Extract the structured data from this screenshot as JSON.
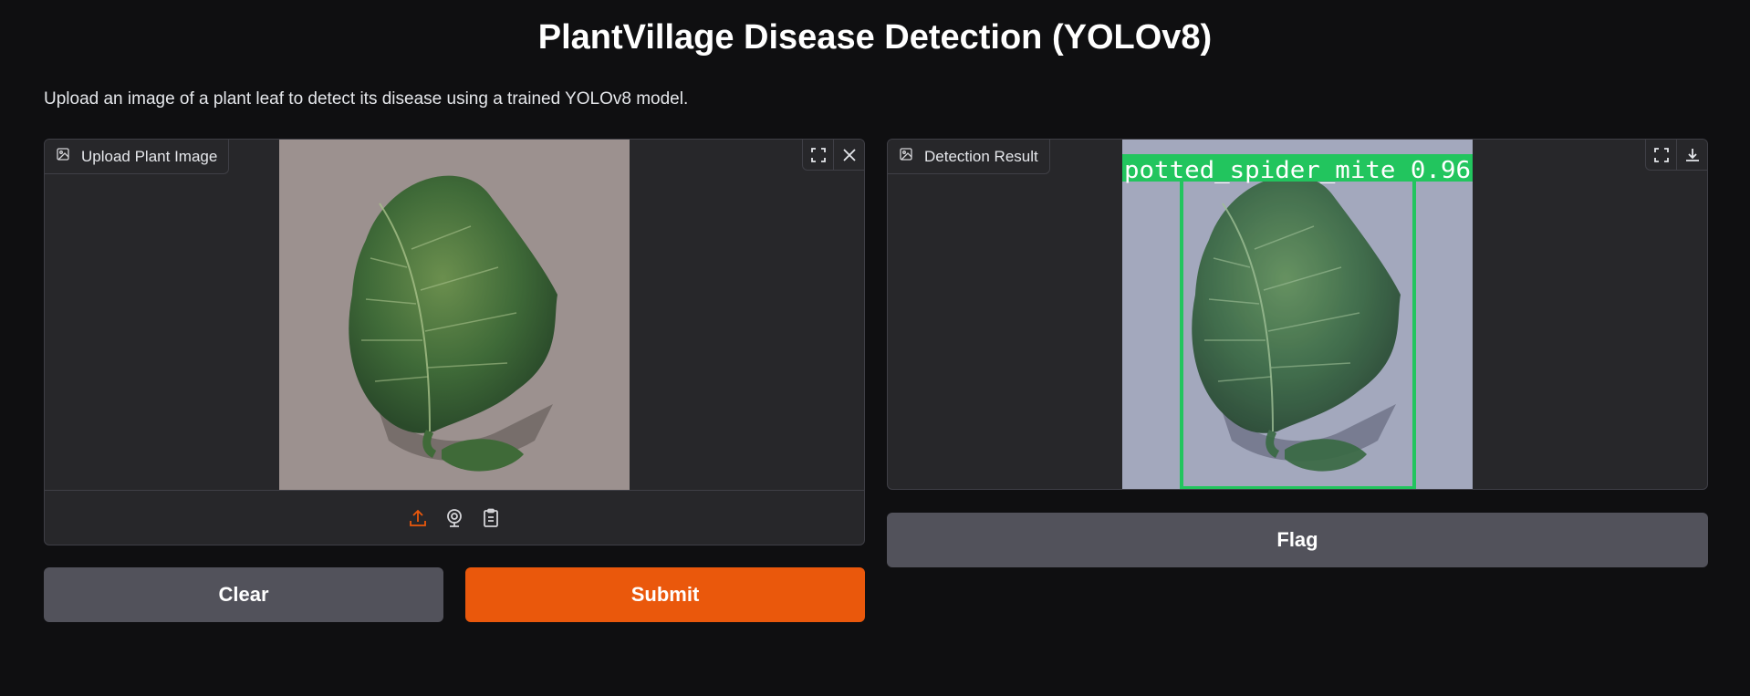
{
  "page": {
    "title": "PlantVillage Disease Detection (YOLOv8)",
    "description": "Upload an image of a plant leaf to detect its disease using a trained YOLOv8 model."
  },
  "input_panel": {
    "label": "Upload Plant Image",
    "label_icon": "image-icon",
    "corner_icons": [
      "fullscreen-icon",
      "close-icon"
    ],
    "source_icons": [
      "upload-icon",
      "webcam-icon",
      "clipboard-icon"
    ]
  },
  "output_panel": {
    "label": "Detection Result",
    "label_icon": "image-icon",
    "corner_icons": [
      "fullscreen-icon",
      "download-icon"
    ],
    "detection_label": "potted_spider_mite 0.96",
    "box_color": "#22c55e"
  },
  "buttons": {
    "clear": "Clear",
    "submit": "Submit",
    "flag": "Flag"
  },
  "colors": {
    "background": "#0f0f11",
    "panel": "#27272a",
    "accent": "#ea580c",
    "secondary_button": "#52525b"
  }
}
